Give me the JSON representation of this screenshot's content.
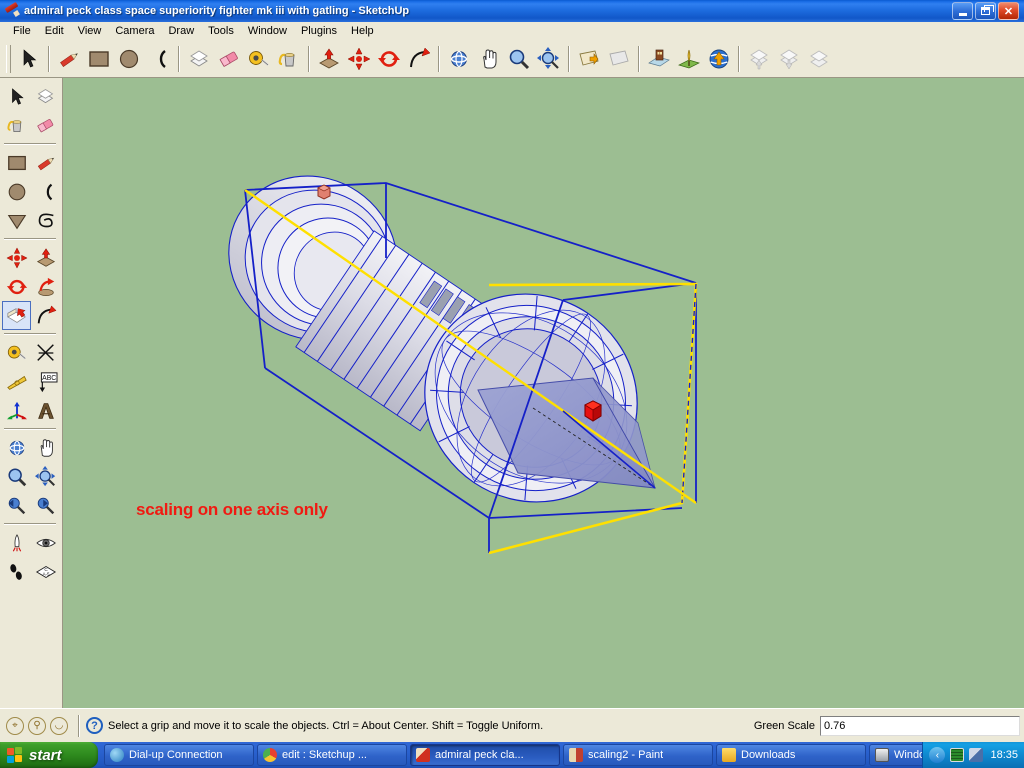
{
  "window": {
    "title": "admiral peck class space superiority fighter mk iii with gatling - SketchUp",
    "app_icon": "sketchup-pencil-icon",
    "buttons": {
      "minimize": "minimize-button",
      "restore": "restore-button",
      "close": "close-button"
    }
  },
  "menu": {
    "items": [
      {
        "label": "File"
      },
      {
        "label": "Edit"
      },
      {
        "label": "View"
      },
      {
        "label": "Camera"
      },
      {
        "label": "Draw"
      },
      {
        "label": "Tools"
      },
      {
        "label": "Window"
      },
      {
        "label": "Plugins"
      },
      {
        "label": "Help"
      }
    ]
  },
  "toolbar_top": {
    "groups": [
      {
        "tools": [
          {
            "name": "select-tool",
            "icon": "arrow-cursor-icon"
          }
        ]
      },
      {
        "tools": [
          {
            "name": "line-tool",
            "icon": "pencil-icon"
          },
          {
            "name": "rectangle-tool",
            "icon": "rectangle-icon"
          },
          {
            "name": "circle-tool",
            "icon": "circle-icon"
          },
          {
            "name": "arc-tool",
            "icon": "arc-icon"
          }
        ]
      },
      {
        "tools": [
          {
            "name": "make-component-tool",
            "icon": "component-icon"
          },
          {
            "name": "eraser-tool",
            "icon": "eraser-icon"
          },
          {
            "name": "tape-measure-tool",
            "icon": "tape-measure-icon"
          },
          {
            "name": "paint-bucket-tool",
            "icon": "paint-bucket-icon"
          }
        ]
      },
      {
        "tools": [
          {
            "name": "push-pull-tool",
            "icon": "push-pull-icon"
          },
          {
            "name": "move-tool",
            "icon": "move-arrows-icon"
          },
          {
            "name": "rotate-tool",
            "icon": "rotate-icon"
          },
          {
            "name": "follow-me-tool",
            "icon": "follow-me-icon"
          }
        ]
      },
      {
        "tools": [
          {
            "name": "orbit-tool",
            "icon": "orbit-icon"
          },
          {
            "name": "pan-tool",
            "icon": "hand-icon"
          },
          {
            "name": "zoom-tool",
            "icon": "magnifier-icon"
          },
          {
            "name": "zoom-extents-tool",
            "icon": "zoom-extents-icon"
          }
        ]
      },
      {
        "tools": [
          {
            "name": "section-plane-tool",
            "icon": "section-plane-icon"
          },
          {
            "name": "section-display-tool",
            "icon": "section-display-icon"
          }
        ]
      },
      {
        "tools": [
          {
            "name": "add-location-tool",
            "icon": "geo-location-icon"
          },
          {
            "name": "toggle-terrain-tool",
            "icon": "terrain-icon"
          },
          {
            "name": "share-model-tool",
            "icon": "globe-upload-icon"
          }
        ]
      },
      {
        "tools": [
          {
            "name": "get-models-tool",
            "icon": "warehouse-download-icon"
          },
          {
            "name": "share-component-tool",
            "icon": "warehouse-upload-icon"
          },
          {
            "name": "model-info-tool",
            "icon": "warehouse-model-icon"
          }
        ]
      }
    ]
  },
  "toolbar_left": {
    "groups": [
      {
        "rows": [
          [
            {
              "name": "select-tool",
              "icon": "arrow-cursor-icon"
            },
            {
              "name": "make-component-tool",
              "icon": "component-icon"
            }
          ],
          [
            {
              "name": "paint-bucket-tool",
              "icon": "paint-bucket-icon"
            },
            {
              "name": "eraser-tool",
              "icon": "eraser-icon"
            }
          ]
        ]
      },
      {
        "rows": [
          [
            {
              "name": "rectangle-tool",
              "icon": "rectangle-icon"
            },
            {
              "name": "line-tool",
              "icon": "pencil-icon"
            }
          ],
          [
            {
              "name": "circle-tool",
              "icon": "circle-icon"
            },
            {
              "name": "arc-tool",
              "icon": "arc-icon"
            }
          ],
          [
            {
              "name": "polygon-tool",
              "icon": "polygon-icon"
            },
            {
              "name": "freehand-tool",
              "icon": "freehand-icon"
            }
          ]
        ]
      },
      {
        "rows": [
          [
            {
              "name": "move-tool",
              "icon": "move-arrows-icon"
            },
            {
              "name": "push-pull-tool",
              "icon": "push-pull-icon"
            }
          ],
          [
            {
              "name": "rotate-tool",
              "icon": "rotate-icon"
            },
            {
              "name": "follow-me-tool",
              "icon": "follow-me-icon"
            }
          ],
          [
            {
              "name": "scale-tool",
              "icon": "scale-icon",
              "active": true
            },
            {
              "name": "offset-tool",
              "icon": "offset-icon"
            }
          ]
        ]
      },
      {
        "rows": [
          [
            {
              "name": "tape-measure-tool",
              "icon": "tape-measure-icon"
            },
            {
              "name": "dimension-tool",
              "icon": "dimension-icon"
            }
          ],
          [
            {
              "name": "protractor-tool",
              "icon": "protractor-icon"
            },
            {
              "name": "text-tool",
              "icon": "text-label-icon"
            }
          ],
          [
            {
              "name": "axes-tool",
              "icon": "axes-icon"
            },
            {
              "name": "three-d-text-tool",
              "icon": "3d-text-icon"
            }
          ]
        ]
      },
      {
        "rows": [
          [
            {
              "name": "orbit-tool",
              "icon": "orbit-icon"
            },
            {
              "name": "pan-tool",
              "icon": "hand-icon"
            }
          ],
          [
            {
              "name": "zoom-tool",
              "icon": "magnifier-icon"
            },
            {
              "name": "zoom-extents-tool",
              "icon": "zoom-extents-icon"
            }
          ],
          [
            {
              "name": "previous-view-tool",
              "icon": "previous-view-icon"
            },
            {
              "name": "next-view-tool",
              "icon": "next-view-icon"
            }
          ]
        ]
      },
      {
        "rows": [
          [
            {
              "name": "position-camera-tool",
              "icon": "position-camera-icon"
            },
            {
              "name": "look-around-tool",
              "icon": "eye-icon"
            }
          ],
          [
            {
              "name": "walk-tool",
              "icon": "footprints-icon"
            },
            {
              "name": "section-cut-tool",
              "icon": "section-cut-icon"
            }
          ]
        ]
      }
    ]
  },
  "viewport": {
    "background_color": "#9CBE92",
    "annotation": "scaling on one axis only",
    "annotation_color": "#F01A12",
    "selection": {
      "bounding_box_color": "#1520C8",
      "active_face_color": "#FFE000",
      "grip_color": "#E81010",
      "inactive_grip_color": "#E08070",
      "model_face_color": "#A8AEDC",
      "model_edge_color": "#1520C8",
      "model_highlight_color": "#DCDCE4"
    }
  },
  "status_bar": {
    "geo_icons": [
      "shadow-north-icon",
      "shadow-person-icon",
      "shadow-time-icon"
    ],
    "help_icon": "question-mark-icon",
    "message": "Select a grip and move it to scale the objects. Ctrl = About Center. Shift = Toggle Uniform.",
    "vcb_label": "Green Scale",
    "vcb_value": "0.76"
  },
  "taskbar": {
    "start_label": "start",
    "start_icon": "windows-flag-icon",
    "tasks": [
      {
        "label": "Dial-up Connection",
        "icon": "network-globe-icon",
        "icon_color": "#3A8FD0",
        "active": false
      },
      {
        "label": "edit : Sketchup ...",
        "icon": "chrome-icon",
        "icon_color": "#E8A020",
        "active": false
      },
      {
        "label": "admiral peck cla...",
        "icon": "sketchup-pencil-icon",
        "icon_color": "#D03020",
        "active": true
      },
      {
        "label": "scaling2 - Paint",
        "icon": "paint-brushes-icon",
        "icon_color": "#C8B048",
        "active": false
      },
      {
        "label": "Downloads",
        "icon": "folder-icon",
        "icon_color": "#F5C43A",
        "active": false
      },
      {
        "label": "Windows Task M...",
        "icon": "task-manager-icon",
        "icon_color": "#C8C8C8",
        "active": false
      }
    ],
    "tray": {
      "chevron_icon": "chevron-left-icon",
      "icons": [
        "network-monitor-icon",
        "network-status-icon"
      ],
      "clock": "18:35"
    }
  }
}
